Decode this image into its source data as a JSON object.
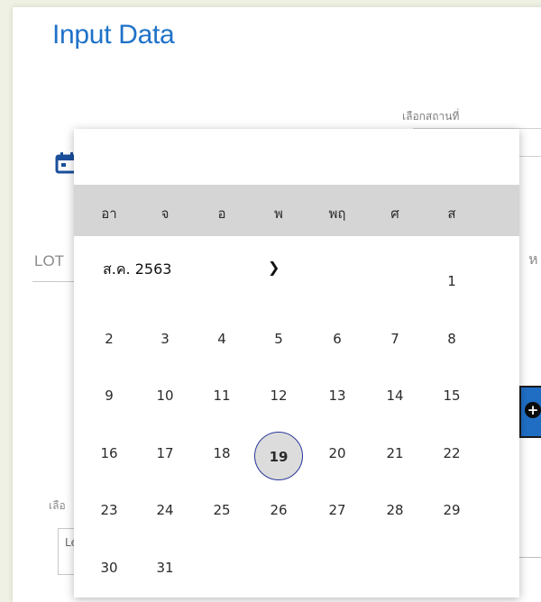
{
  "header": {
    "title": "Input Data"
  },
  "location": {
    "label": "เลือกสถานที่"
  },
  "form": {
    "lot_label": "LOT",
    "right_partial": "ห",
    "select_label": "เลือ",
    "select_value": "Lé",
    "add_icon": "+"
  },
  "calendar": {
    "month_label": "ส.ค. 2563",
    "next_icon": "chevron-right",
    "weekdays": [
      "อา",
      "จ",
      "อ",
      "พ",
      "พฤ",
      "ศ",
      "ส"
    ],
    "days": [
      "1",
      "2",
      "3",
      "4",
      "5",
      "6",
      "7",
      "8",
      "9",
      "10",
      "11",
      "12",
      "13",
      "14",
      "15",
      "16",
      "17",
      "18",
      "19",
      "20",
      "21",
      "22",
      "23",
      "24",
      "25",
      "26",
      "27",
      "28",
      "29",
      "30",
      "31"
    ],
    "selected_day": "19",
    "accent": "#1f72c8",
    "selected_border": "#2a3a9a"
  }
}
